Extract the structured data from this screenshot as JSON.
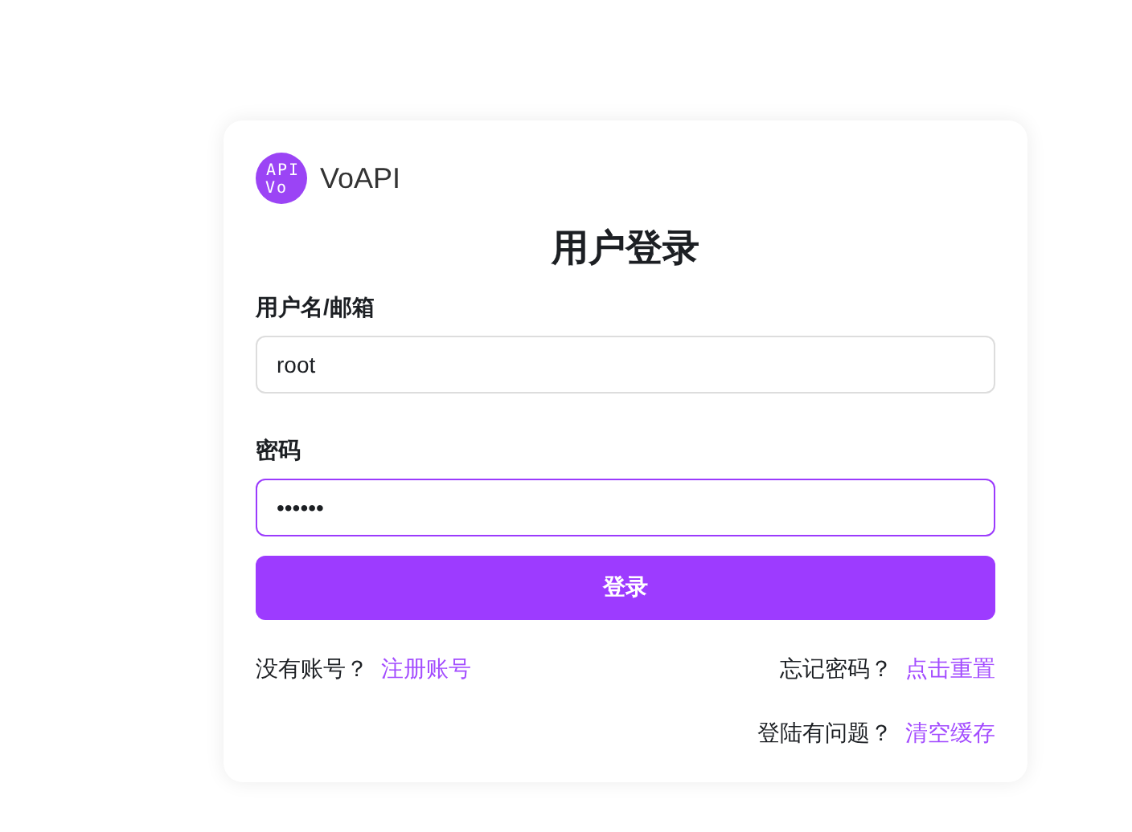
{
  "brand": {
    "logo_lines": [
      "API",
      "Vo"
    ],
    "name": "VoAPI"
  },
  "title": "用户登录",
  "fields": [
    {
      "label": "用户名/邮箱",
      "value": "root",
      "focused": false
    },
    {
      "label": "密码",
      "value": "••••••",
      "focused": true
    }
  ],
  "submit": "登录",
  "link_rows": [
    {
      "start": {
        "prompt": "没有账号？",
        "link": "注册账号"
      },
      "end": {
        "prompt": "忘记密码？",
        "link": "点击重置"
      }
    },
    {
      "end": {
        "prompt": "登陆有问题？",
        "link": "清空缓存"
      }
    }
  ]
}
